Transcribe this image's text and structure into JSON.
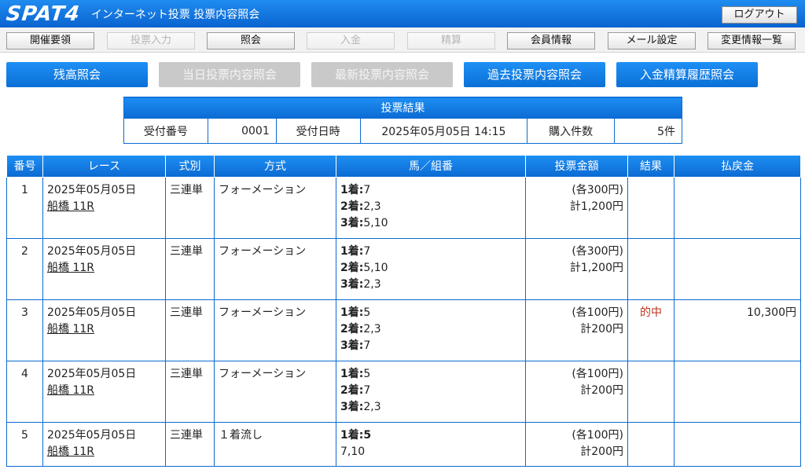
{
  "header": {
    "logo": "SPAT4",
    "title": "インターネット投票 投票内容照会",
    "logout": "ログアウト"
  },
  "nav": [
    {
      "label": "開催要領",
      "disabled": false
    },
    {
      "label": "投票入力",
      "disabled": true
    },
    {
      "label": "照会",
      "disabled": false
    },
    {
      "label": "入金",
      "disabled": true
    },
    {
      "label": "精算",
      "disabled": true
    },
    {
      "label": "会員情報",
      "disabled": false
    },
    {
      "label": "メール設定",
      "disabled": false
    },
    {
      "label": "変更情報一覧",
      "disabled": false
    }
  ],
  "submenu": [
    {
      "label": "残高照会",
      "disabled": false
    },
    {
      "label": "当日投票内容照会",
      "disabled": true
    },
    {
      "label": "最新投票内容照会",
      "disabled": true
    },
    {
      "label": "過去投票内容照会",
      "disabled": false
    },
    {
      "label": "入金精算履歴照会",
      "disabled": false
    }
  ],
  "summary": {
    "title": "投票結果",
    "receipt_label": "受付番号",
    "receipt_value": "0001",
    "datetime_label": "受付日時",
    "datetime_value": "2025年05月05日 14:15",
    "count_label": "購入件数",
    "count_value": "5件"
  },
  "table": {
    "headers": [
      "番号",
      "レース",
      "式別",
      "方式",
      "馬／組番",
      "投票金額",
      "結果",
      "払戻金"
    ],
    "rows": [
      {
        "no": "1",
        "date": "2025年05月05日",
        "race": "船橋 11R",
        "type": "三連単",
        "method": "フォーメーション",
        "first_label": "1着:",
        "first": "7",
        "second_label": "2着:",
        "second": "2,3",
        "third_label": "3着:",
        "third": "5,10",
        "each": "(各300円)",
        "total": "計1,200円",
        "result": "",
        "payout": ""
      },
      {
        "no": "2",
        "date": "2025年05月05日",
        "race": "船橋 11R",
        "type": "三連単",
        "method": "フォーメーション",
        "first_label": "1着:",
        "first": "7",
        "second_label": "2着:",
        "second": "5,10",
        "third_label": "3着:",
        "third": "2,3",
        "each": "(各300円)",
        "total": "計1,200円",
        "result": "",
        "payout": ""
      },
      {
        "no": "3",
        "date": "2025年05月05日",
        "race": "船橋 11R",
        "type": "三連単",
        "method": "フォーメーション",
        "first_label": "1着:",
        "first": "5",
        "second_label": "2着:",
        "second": "2,3",
        "third_label": "3着:",
        "third": "7",
        "each": "(各100円)",
        "total": "計200円",
        "result": "的中",
        "payout": "10,300円"
      },
      {
        "no": "4",
        "date": "2025年05月05日",
        "race": "船橋 11R",
        "type": "三連単",
        "method": "フォーメーション",
        "first_label": "1着:",
        "first": "5",
        "second_label": "2着:",
        "second": "7",
        "third_label": "3着:",
        "third": "2,3",
        "each": "(各100円)",
        "total": "計200円",
        "result": "",
        "payout": ""
      },
      {
        "no": "5",
        "date": "2025年05月05日",
        "race": "船橋 11R",
        "type": "三連単",
        "method": "１着流し",
        "first_label": "1着:5",
        "first": "",
        "line2": "7,10",
        "each": "(各100円)",
        "total": "計200円",
        "result": "",
        "payout": ""
      }
    ]
  },
  "colors": {
    "primary": "#0b6bd3",
    "hit": "#c0311d",
    "disabled": "#c9c9c9"
  }
}
